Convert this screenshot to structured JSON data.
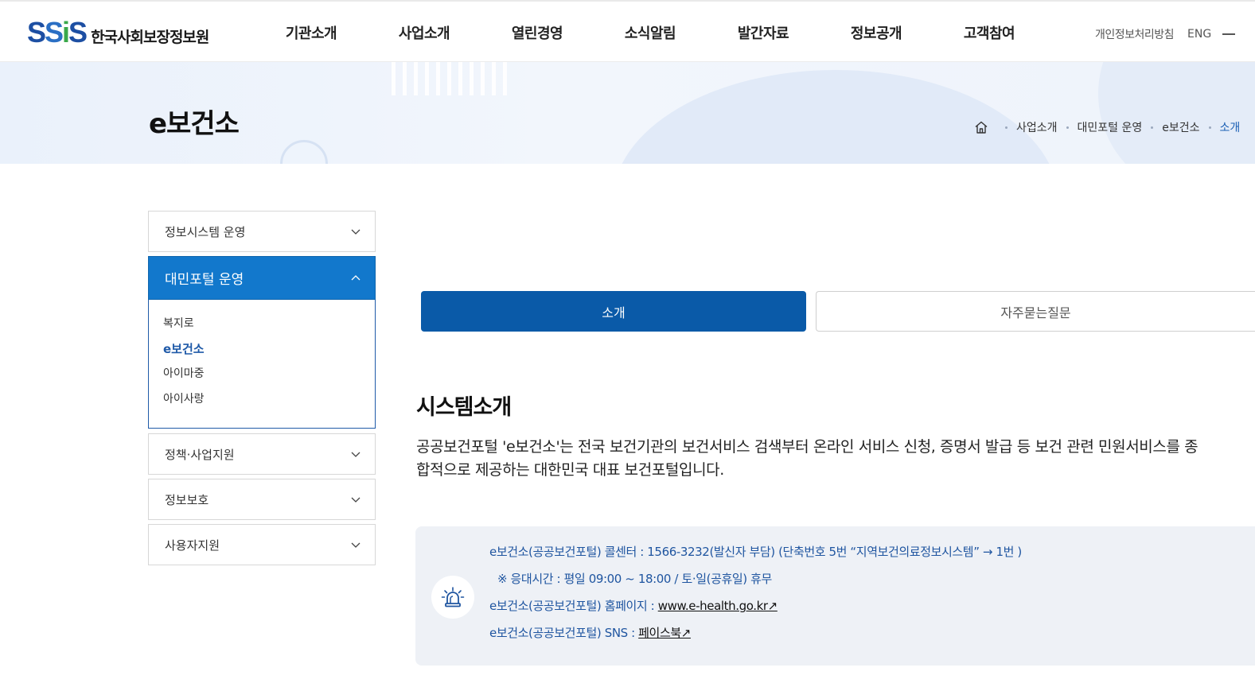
{
  "header": {
    "logo_mark": "SSiS",
    "logo_text": "한국사회보장정보원",
    "nav": [
      "기관소개",
      "사업소개",
      "열린경영",
      "소식알림",
      "발간자료",
      "정보공개",
      "고객참여"
    ],
    "util_privacy": "개인정보처리방침",
    "util_lang": "ENG"
  },
  "banner": {
    "title": "e보건소",
    "breadcrumb": [
      "사업소개",
      "대민포털 운영",
      "e보건소",
      "소개"
    ]
  },
  "sidebar": {
    "items": [
      {
        "label": "정보시스템 운영"
      },
      {
        "label": "대민포털 운영",
        "sub": [
          "복지로",
          "e보건소",
          "아이마중",
          "아이사랑"
        ]
      },
      {
        "label": "정책·사업지원"
      },
      {
        "label": "정보보호"
      },
      {
        "label": "사용자지원"
      }
    ]
  },
  "tabs": {
    "intro": "소개",
    "faq": "자주묻는질문"
  },
  "content": {
    "title": "시스템소개",
    "desc": "공공보건포털 'e보건소'는 전국 보건기관의 보건서비스 검색부터 온라인 서비스 신청, 증명서 발급 등 보건 관련 민원서비스를 종합적으로 제공하는 대한민국 대표 보건포털입니다.",
    "info": {
      "line1": "e보건소(공공보건포털) 콜센터 : 1566-3232(발신자 부담) (단축번호 5번 “지역보건의료정보시스템” → 1번 )",
      "line2": "※ 응대시간 : 평일 09:00 ~ 18:00 / 토·일(공휴일) 휴무",
      "line3_prefix": "e보건소(공공보건포털) 홈페이지 : ",
      "line3_link": "www.e-health.go.kr↗",
      "line4_prefix": "e보건소(공공보건포털) SNS : ",
      "line4_link": "페이스북↗"
    }
  },
  "colors": {
    "primary": "#0a5aa8",
    "sidebar_active": "#1278cc",
    "info_text": "#1f55a0",
    "info_bg": "#eef1f6"
  }
}
